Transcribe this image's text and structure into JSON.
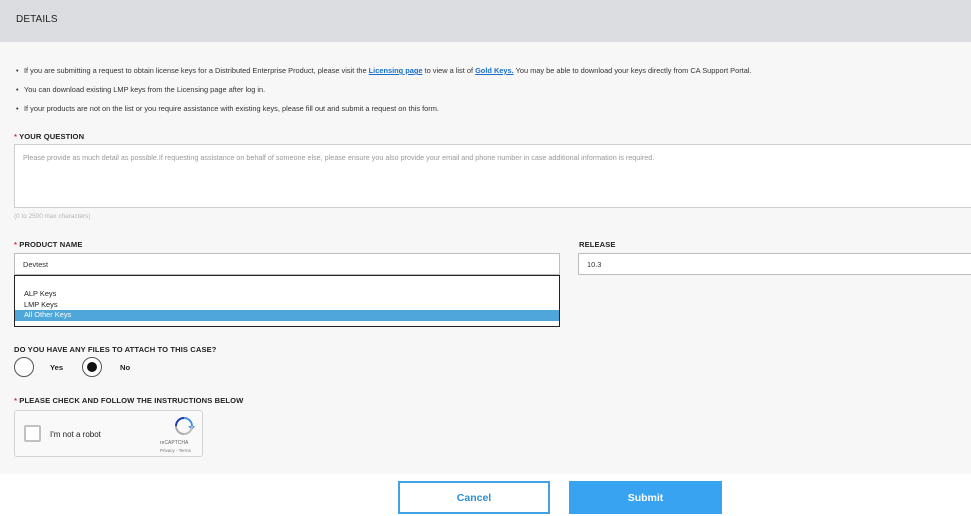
{
  "header": {
    "title": "DETAILS"
  },
  "info_bullets": [
    {
      "text_before": "If you are submitting a request to obtain license keys for a Distributed Enterprise Product, please visit the ",
      "link1": "Licensing page",
      "text_middle": " to view a list of ",
      "link2": "Gold Keys.",
      "text_after": " You may be able to download your keys directly from CA Support Portal."
    },
    {
      "text": "You can download existing LMP keys from the Licensing page after log in."
    },
    {
      "text": "If your products are not on the list or you require assistance with existing keys, please fill out and submit a request on this form."
    }
  ],
  "question": {
    "required_mark": "*",
    "label": "YOUR QUESTION",
    "placeholder": "Please provide as much detail as possible.If requesting assistance on behalf of someone else, please ensure you also provide your email and phone number in case additional information is required.",
    "char_hint": "(0 to 2500 max characters)"
  },
  "product": {
    "required_mark": "*",
    "label": "PRODUCT NAME",
    "value": "Devtest",
    "options": [
      "ALP Keys",
      "LMP Keys",
      "All Other Keys"
    ],
    "selected_index": 2
  },
  "release": {
    "label": "RELEASE",
    "value": "10.3"
  },
  "attach": {
    "label": "DO YOU HAVE ANY FILES TO ATTACH TO THIS CASE?",
    "yes_label": "Yes",
    "no_label": "No",
    "selected": "No"
  },
  "captcha_section": {
    "required_mark": "*",
    "label": "PLEASE CHECK AND FOLLOW THE INSTRUCTIONS BELOW",
    "checkbox_text": "I'm not a robot",
    "brand": "reCAPTCHA",
    "links": "Privacy - Terms"
  },
  "actions": {
    "cancel_label": "Cancel",
    "submit_label": "Submit"
  },
  "colors": {
    "header_bg": "#dcdde1",
    "link": "#1b6fc9",
    "required": "#e0282e",
    "accent": "#38a3f0",
    "selected_option": "#4fa6d9"
  }
}
